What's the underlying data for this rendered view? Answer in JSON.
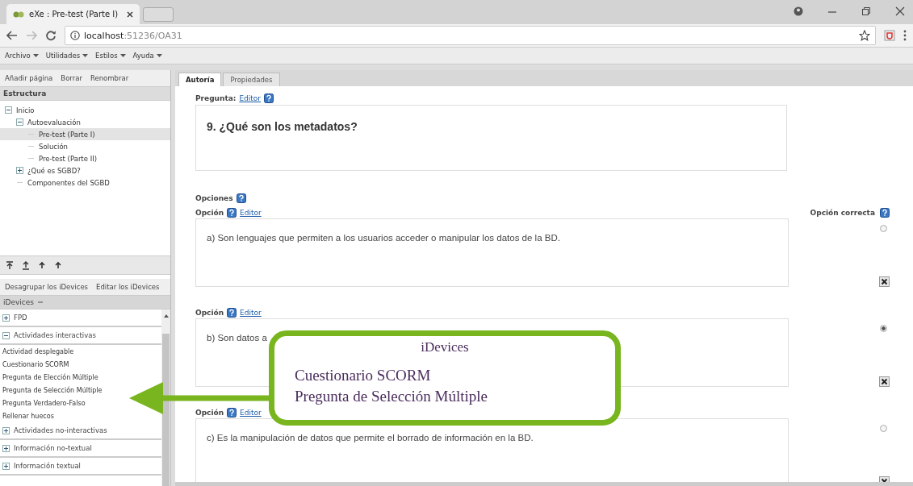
{
  "browser": {
    "tab_title": "eXe : Pre-test (Parte I)",
    "url_host": "localhost",
    "url_path": ":51236/OA31"
  },
  "menu": [
    "Archivo",
    "Utilidades",
    "Estilos",
    "Ayuda"
  ],
  "outline_toolbar": [
    "Añadir página",
    "Borrar",
    "Renombrar"
  ],
  "structure": {
    "title": "Estructura",
    "tree": [
      {
        "label": "Inicio",
        "expanded": true,
        "selected": false,
        "children": [
          {
            "label": "Autoevaluación",
            "expanded": true,
            "selected": false,
            "children": [
              {
                "label": "Pre-test (Parte I)",
                "selected": true
              },
              {
                "label": "Solución",
                "selected": false
              },
              {
                "label": "Pre-test (Parte II)",
                "selected": false
              }
            ]
          },
          {
            "label": "¿Qué es SGBD?",
            "expanded": false,
            "selected": false
          },
          {
            "label": "Componentes del SGBD",
            "selected": false
          }
        ]
      }
    ]
  },
  "idevice_toolbar": [
    "Desagrupar los iDevices",
    "Editar los iDevices"
  ],
  "idevices": {
    "title": "iDevices",
    "groups": [
      {
        "label": "FPD",
        "expanded": false
      },
      {
        "label": "Actividades interactivas",
        "expanded": true,
        "items": [
          "Actividad desplegable",
          "Cuestionario SCORM",
          "Pregunta de Elección Múltiple",
          "Pregunta de Selección Múltiple",
          "Pregunta Verdadero-Falso",
          "Rellenar huecos"
        ]
      },
      {
        "label": "Actividades no-interactivas",
        "expanded": false
      },
      {
        "label": "Información no-textual",
        "expanded": false
      },
      {
        "label": "Información textual",
        "expanded": false
      }
    ]
  },
  "editor_tabs": [
    {
      "label": "Autoría",
      "selected": true
    },
    {
      "label": "Propiedades",
      "selected": false
    }
  ],
  "question": {
    "label": "Pregunta:",
    "editor_link": "Editor",
    "text": "9. ¿Qué son los metadatos?"
  },
  "options_label": "Opciones",
  "correct_label": "Opción correcta",
  "options": [
    {
      "label": "Opción",
      "editor_link": "Editor",
      "text": "a) Son lenguajes que permiten a los usuarios acceder o manipular los datos de la BD.",
      "selected": false
    },
    {
      "label": "Opción",
      "editor_link": "Editor",
      "text": "b) Son datos a",
      "selected": true
    },
    {
      "label": "Opción",
      "editor_link": "Editor",
      "text": "c) Es la manipulación de datos que permite el borrado de información en la BD.",
      "selected": false
    }
  ],
  "callout": {
    "title": "iDevices",
    "lines": [
      "Cuestionario SCORM",
      "Pregunta de Selección Múltiple"
    ]
  }
}
